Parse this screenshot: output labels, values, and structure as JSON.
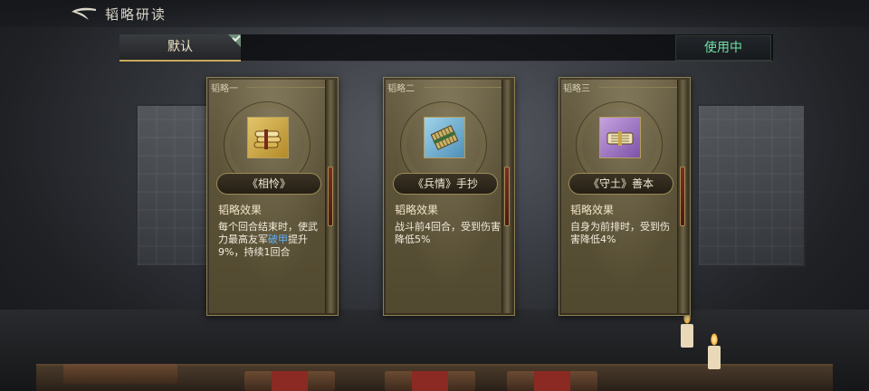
{
  "header": {
    "title": "韬略研读"
  },
  "tabs": {
    "default_label": "默认",
    "in_use_label": "使用中"
  },
  "cards": [
    {
      "tag": "韬略一",
      "name": "《相怜》",
      "icon": "scroll-bundle-gold-icon",
      "effect_title": "韬略效果",
      "effect_pre": "每个回合结束时，使武力最高友军",
      "effect_highlight": "破甲",
      "effect_post": "提升9%，持续1回合"
    },
    {
      "tag": "韬略二",
      "name": "《兵情》手抄",
      "icon": "bamboo-scroll-blue-icon",
      "effect_title": "韬略效果",
      "effect_pre": "战斗前4回合，受到伤害降低5%",
      "effect_highlight": "",
      "effect_post": ""
    },
    {
      "tag": "韬略三",
      "name": "《守土》善本",
      "icon": "scroll-purple-icon",
      "effect_title": "韬略效果",
      "effect_pre": "自身为前排时，受到伤害降低4%",
      "effect_highlight": "",
      "effect_post": ""
    }
  ],
  "colors": {
    "in_use_text": "#6fe0a8",
    "highlight_text": "#5fb0ff",
    "card_bg": "#5c5339"
  }
}
